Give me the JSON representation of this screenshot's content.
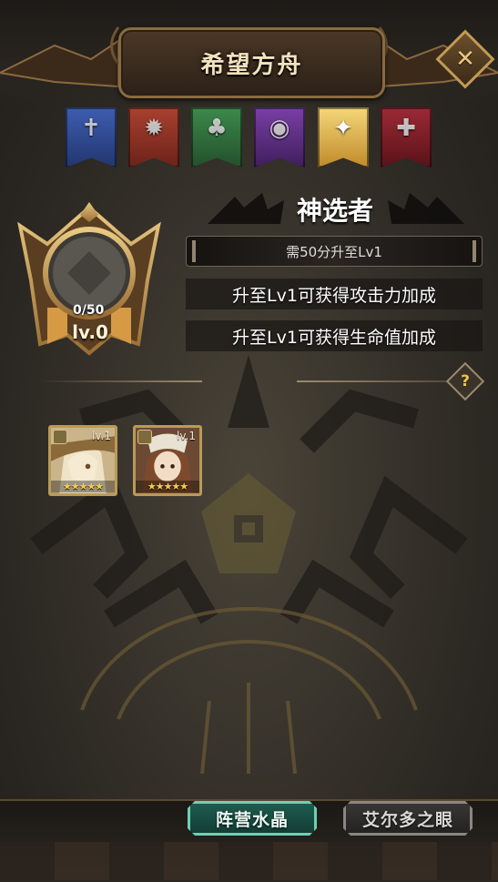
{
  "header": {
    "title": "希望方舟"
  },
  "factions": [
    {
      "name": "faction-blue",
      "color": "#2f4a8f",
      "symbol": "✝",
      "selected": false
    },
    {
      "name": "faction-red",
      "color": "#8c2f24",
      "symbol": "✹",
      "selected": false
    },
    {
      "name": "faction-green",
      "color": "#2f6e3c",
      "symbol": "♣",
      "selected": false
    },
    {
      "name": "faction-purple",
      "color": "#5a2c7d",
      "symbol": "◉",
      "selected": false
    },
    {
      "name": "faction-gold",
      "color": "#d9a93c",
      "symbol": "✦",
      "selected": true
    },
    {
      "name": "faction-crimson",
      "color": "#7a1e28",
      "symbol": "✚",
      "selected": false
    }
  ],
  "medal": {
    "points": "0/50",
    "level": "lv.0"
  },
  "rank": {
    "title": "神选者",
    "requirement": "需50分升至Lv1",
    "bonuses": [
      "升至Lv1可获得攻击力加成",
      "升至Lv1可获得生命值加成"
    ]
  },
  "heroes": [
    {
      "level": "lv.1",
      "stars": "★★★★★"
    },
    {
      "level": "lv.1",
      "stars": "★★★★★"
    }
  ],
  "tabs": {
    "active": "阵营水晶",
    "inactive": "艾尔多之眼"
  },
  "colors": {
    "gold": "#c9a45c",
    "accent_green": "#6fd0b0"
  }
}
